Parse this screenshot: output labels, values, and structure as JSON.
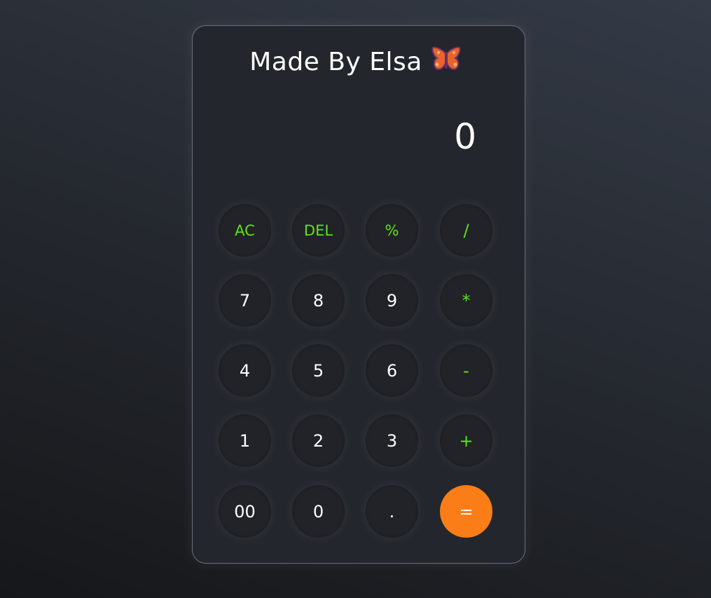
{
  "title": "Made By Elsa",
  "title_icon": "butterfly-icon",
  "display": {
    "value": "0"
  },
  "keypad": {
    "ac": "AC",
    "del": "DEL",
    "percent": "%",
    "divide": "/",
    "seven": "7",
    "eight": "8",
    "nine": "9",
    "multiply": "*",
    "four": "4",
    "five": "5",
    "six": "6",
    "minus": "-",
    "one": "1",
    "two": "2",
    "three": "3",
    "plus": "+",
    "double_zero": "00",
    "zero": "0",
    "dot": ".",
    "equals": "="
  },
  "colors": {
    "operator_text": "#5ee11a",
    "equals_button": "#fb7d17",
    "panel": "#23262c",
    "button": "#212328"
  }
}
